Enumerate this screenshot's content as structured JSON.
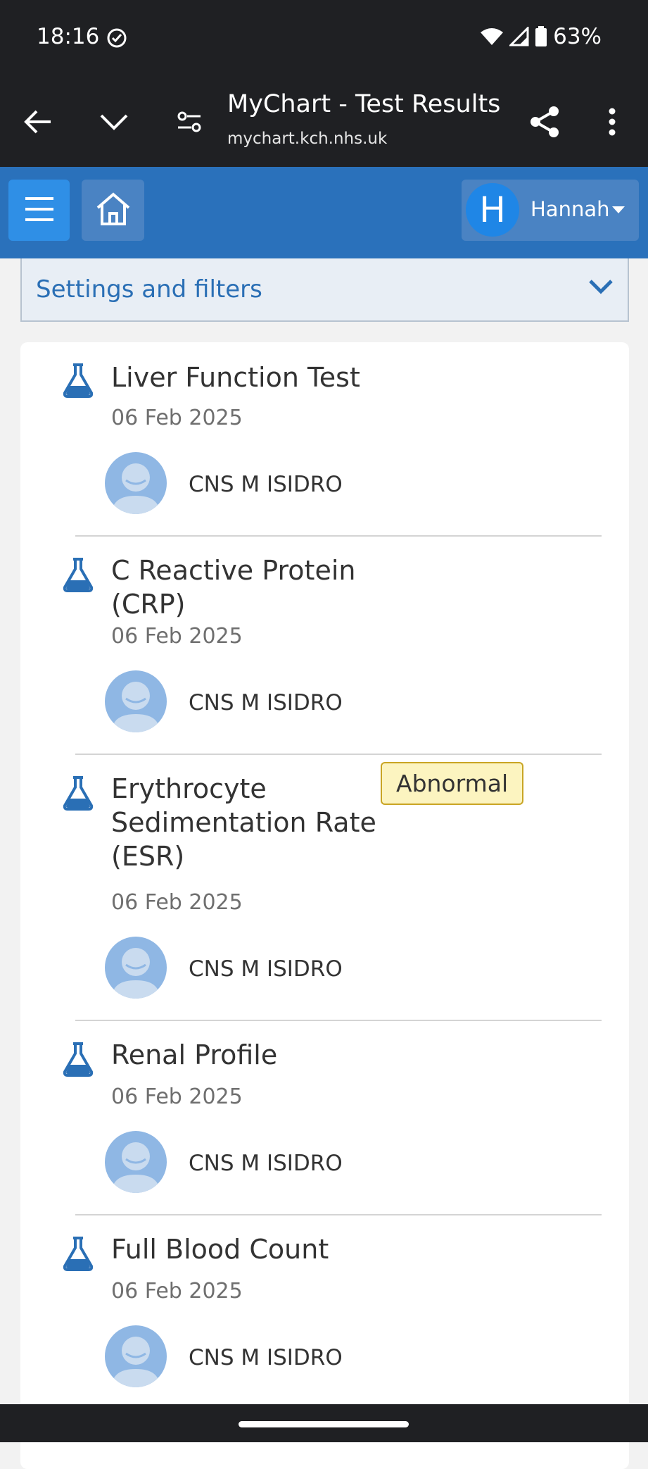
{
  "status_bar": {
    "time": "18:16",
    "battery": "63%"
  },
  "browser": {
    "title": "MyChart - Test Results",
    "url": "mychart.kch.nhs.uk"
  },
  "header": {
    "user_initial": "H",
    "user_name": "Hannah"
  },
  "filters": {
    "label": "Settings and filters"
  },
  "results": [
    {
      "title_lines": [
        "Liver Function Test"
      ],
      "date": "06 Feb 2025",
      "provider": "CNS M ISIDRO",
      "badge": ""
    },
    {
      "title_lines": [
        "C Reactive Protein",
        "(CRP)"
      ],
      "date": "06 Feb 2025",
      "provider": "CNS M ISIDRO",
      "badge": ""
    },
    {
      "title_lines": [
        "Erythrocyte",
        "Sedimentation Rate",
        "(ESR)"
      ],
      "date": "06 Feb 2025",
      "provider": "CNS M ISIDRO",
      "badge": "Abnormal"
    },
    {
      "title_lines": [
        "Renal Profile"
      ],
      "date": "06 Feb 2025",
      "provider": "CNS M ISIDRO",
      "badge": ""
    },
    {
      "title_lines": [
        "Full Blood Count"
      ],
      "date": "06 Feb 2025",
      "provider": "CNS M ISIDRO",
      "badge": ""
    }
  ],
  "colors": {
    "brand_blue": "#2a71bb",
    "link_blue": "#2a6fb5",
    "abnormal_bg": "#fcf4c0",
    "abnormal_border": "#c9a524"
  }
}
